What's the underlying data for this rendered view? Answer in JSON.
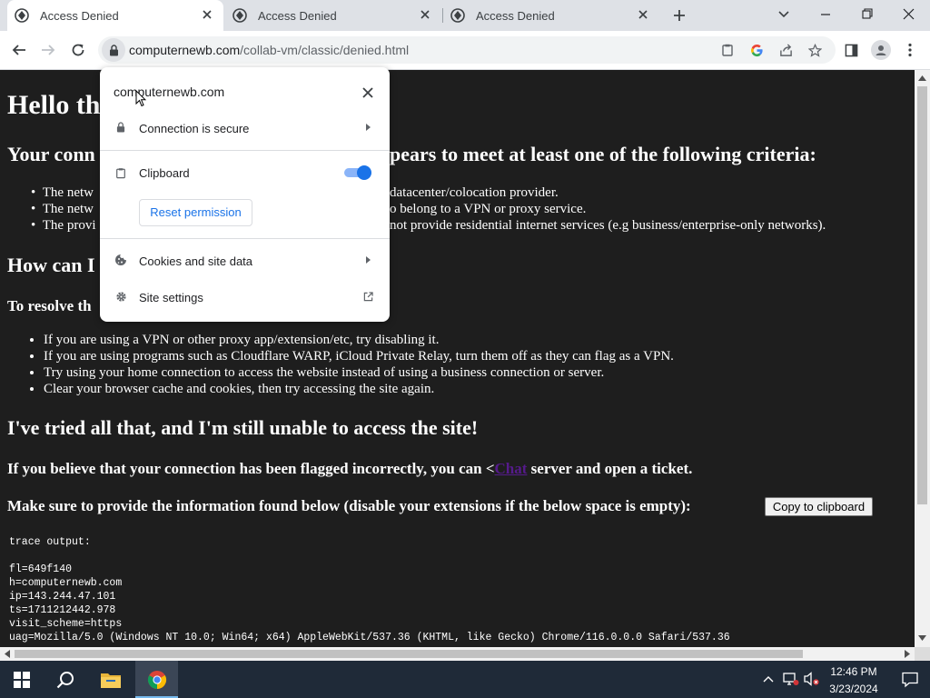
{
  "tabs": [
    {
      "title": "Access Denied",
      "active": true
    },
    {
      "title": "Access Denied",
      "active": false
    },
    {
      "title": "Access Denied",
      "active": false
    }
  ],
  "address_bar": {
    "domain": "computernewb.com",
    "path": "/collab-vm/classic/denied.html"
  },
  "page": {
    "heading": "Hello th",
    "criteria_heading_left": "Your conn",
    "criteria_heading_right": "pears to meet at least one of the following criteria:",
    "criteria": [
      {
        "left": "The netw",
        "right": "datacenter/colocation provider."
      },
      {
        "left": "The netw",
        "right": "o belong to a VPN or proxy service."
      },
      {
        "left": "The provi",
        "right": "not provide residential internet services (e.g business/enterprise-only networks)."
      }
    ],
    "how_heading": "How can I",
    "resolve_heading": "To resolve th",
    "steps": [
      "If you are using a VPN or other proxy app/extension/etc, try disabling it.",
      "If you are using programs such as Cloudflare WARP, iCloud Private Relay, turn them off as they can flag as a VPN.",
      "Try using your home connection to access the website instead of using a business connection or server.",
      "Clear your browser cache and cookies, then try accessing the site again."
    ],
    "tried_heading": "I've tried all that, and I'm still unable to access the site!",
    "flagged_prefix": "If you believe that your connection has been flagged incorrectly, you can <",
    "flagged_link": "Chat",
    "flagged_suffix": " server and open a ticket.",
    "info_heading": "Make sure to provide the information found below (disable your extensions if the below space is empty):",
    "copy_button": "Copy to clipboard",
    "trace_title": "trace output:",
    "trace_lines": [
      "fl=649f140",
      "h=computernewb.com",
      "ip=143.244.47.101",
      "ts=1711212442.978",
      "visit_scheme=https",
      "uag=Mozilla/5.0 (Windows NT 10.0; Win64; x64) AppleWebKit/537.36 (KHTML, like Gecko) Chrome/116.0.0.0 Safari/537.36"
    ]
  },
  "site_info_popup": {
    "domain": "computernewb.com",
    "connection": "Connection is secure",
    "clipboard": "Clipboard",
    "clipboard_enabled": true,
    "reset_button": "Reset permission",
    "cookies": "Cookies and site data",
    "site_settings": "Site settings"
  },
  "taskbar": {
    "time": "12:46 PM",
    "date": "3/23/2024"
  },
  "colors": {
    "accent": "#1a73e8",
    "page_bg": "#1e1e1e",
    "taskbar_bg": "#1f2a38",
    "link_visited": "#551a8b"
  }
}
